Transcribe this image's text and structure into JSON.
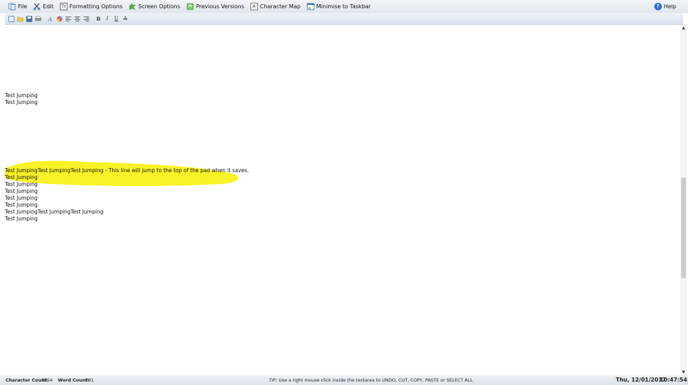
{
  "menu": {
    "file": "File",
    "edit": "Edit",
    "formatting_options": "Formatting Options",
    "formatting_icon_text": "Tr",
    "screen_options": "Screen Options",
    "previous_versions": "Previous Versions",
    "character_map": "Character Map",
    "character_map_icon_text": "A",
    "minimise": "Minimise to Taskbar",
    "help": "Help",
    "help_icon_text": "?"
  },
  "toolbar": {
    "bold": "B",
    "italic": "I",
    "underline": "U",
    "strike": "A"
  },
  "editor": {
    "lines_top": [
      "Test Jumping",
      "Test Jumping"
    ],
    "lines_bottom": [
      "Test JumpingTest JumpingTest Jumping - This line will jump to the top of the pad when it saves.",
      "Test Jumping",
      "Test Jumping",
      "Test Jumping",
      "Test Jumping",
      "Test Jumping",
      "Test JumpingTest JumpingTest Jumping",
      "Test Jumping"
    ],
    "highlight_color": "#f7f21a"
  },
  "status": {
    "char_count_label": "Character Count:",
    "char_count_value": "2054",
    "word_count_label": "Word Count:",
    "word_count_value": "281",
    "tip": "TIP: Use a right mouse click inside the textarea to UNDO, CUT, COPY, PASTE or SELECT ALL",
    "date": "Thu, 12/01/2017",
    "time": "10:47:54"
  },
  "colors": {
    "menubar": "#dfe6ee",
    "accent_blue": "#2f6fcf",
    "scroll_thumb": "#cdcdcd"
  }
}
